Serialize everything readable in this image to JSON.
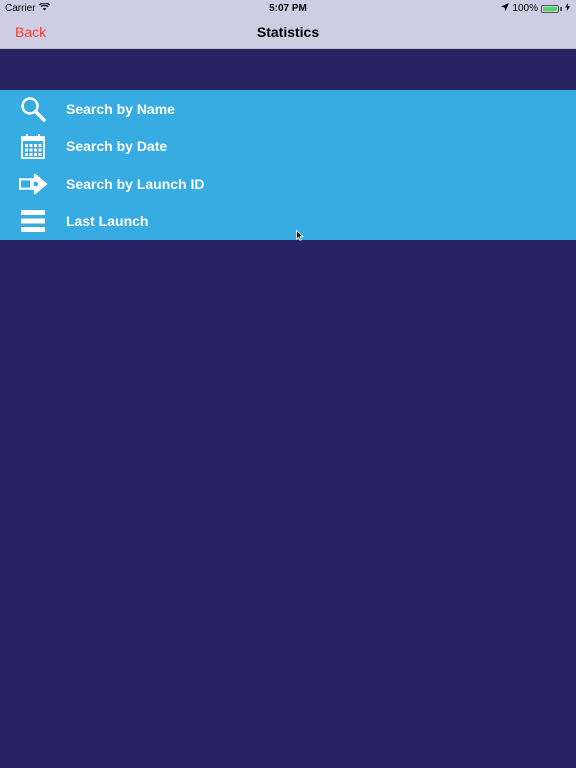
{
  "status_bar": {
    "carrier": "Carrier",
    "time": "5:07 PM",
    "battery": "100%",
    "wifi_icon": "wifi-icon",
    "location_icon": "location-arrow-icon",
    "battery_icon": "battery-icon",
    "battery_color": "#4cd964"
  },
  "nav": {
    "back_label": "Back",
    "title": "Statistics",
    "back_color": "#ff3b30"
  },
  "menu": {
    "background_color": "#36ace2",
    "items": [
      {
        "label": "Search by Name",
        "icon": "search-icon"
      },
      {
        "label": "Search by Date",
        "icon": "calendar-icon"
      },
      {
        "label": "Search by Launch ID",
        "icon": "arrow-tag-icon"
      },
      {
        "label": "Last Launch",
        "icon": "list-icon"
      }
    ]
  },
  "colors": {
    "page_background": "#262462",
    "bar_background": "#cfcde3"
  }
}
